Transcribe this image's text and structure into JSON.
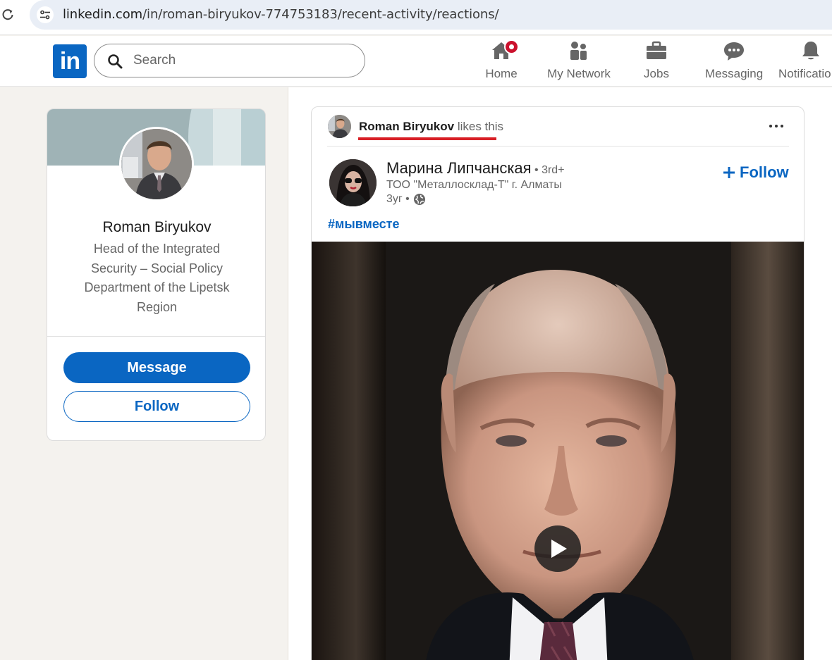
{
  "browser": {
    "url_host": "linkedin.com",
    "url_path": "/in/roman-biryukov-774753183/recent-activity/reactions/"
  },
  "nav": {
    "logo": "in",
    "search_placeholder": "Search",
    "items": [
      {
        "label": "Home",
        "icon": "home-icon",
        "badge": true
      },
      {
        "label": "My Network",
        "icon": "network-icon"
      },
      {
        "label": "Jobs",
        "icon": "briefcase-icon"
      },
      {
        "label": "Messaging",
        "icon": "messaging-icon"
      },
      {
        "label": "Notificatio",
        "icon": "bell-icon"
      }
    ]
  },
  "profile": {
    "name": "Roman Biryukov",
    "headline": "Head of the Integrated Security – Social Policy Department of the Lipetsk Region",
    "message_label": "Message",
    "follow_label": "Follow"
  },
  "post": {
    "actor": "Roman Biryukov",
    "action": " likes this",
    "author_name": "Марина Липчанская",
    "author_degree": " • 3rd+",
    "author_org": "ТОО \"Металлосклад-Т\" г. Алматы",
    "author_time": "3уг •",
    "follow_label": "Follow",
    "hashtag": "#мывместе"
  },
  "colors": {
    "linkedin_blue": "#0a66c2",
    "highlight_red": "#d81f26",
    "badge_red": "#cb112d"
  }
}
